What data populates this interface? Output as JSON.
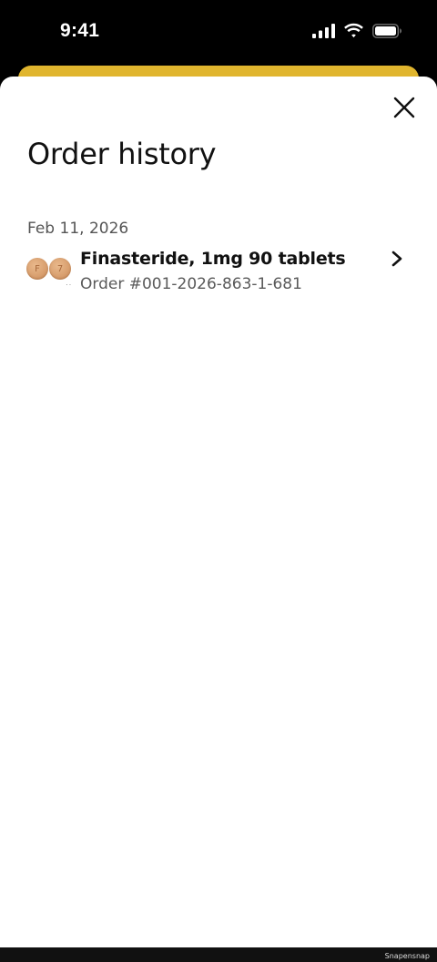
{
  "status_bar": {
    "time": "9:41",
    "icons": [
      "cellular-signal-icon",
      "wifi-icon",
      "battery-icon"
    ]
  },
  "sheet": {
    "title": "Order history",
    "close_icon": "close-icon"
  },
  "orders": [
    {
      "date": "Feb 11, 2026",
      "name": "Finasteride, 1mg 90 tablets",
      "order_number": "Order #001-2026-863-1-681",
      "thumbnail": "pill-thumbnail",
      "pill_marks": [
        "F",
        "7"
      ],
      "chevron_icon": "chevron-right-icon"
    }
  ],
  "colors": {
    "accent_card": "#e0b52e",
    "background": "#ffffff",
    "text_primary": "#111111",
    "text_secondary": "#5a5a5a"
  },
  "watermark": "Snapensnap"
}
